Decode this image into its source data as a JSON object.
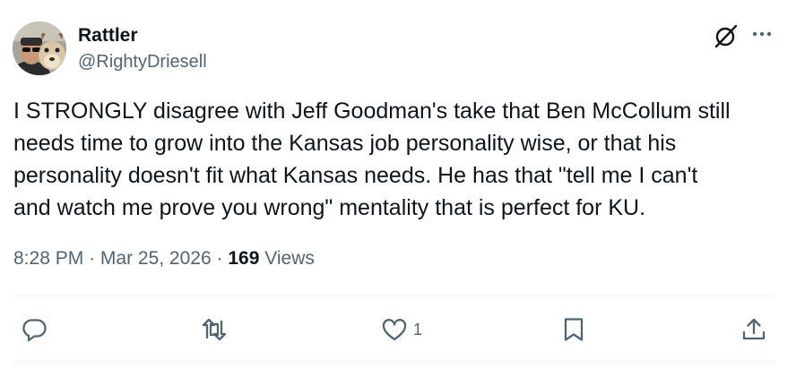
{
  "author": {
    "display_name": "Rattler",
    "handle": "@RightyDriesell"
  },
  "tweet": {
    "text": "I STRONGLY disagree with Jeff Goodman's take that Ben McCollum still\nneeds time to grow into the Kansas job personality wise, or that his\npersonality doesn't fit what Kansas needs. He has that \"tell me I can't\nand watch me prove you wrong\" mentality that is perfect for KU.",
    "time": "8:28 PM",
    "separator": "·",
    "date": "Mar 25, 2026",
    "views_count": "169",
    "views_label": "Views"
  },
  "actions": {
    "likes_count": "1"
  },
  "icons": {
    "header": [
      "grok-icon",
      "more-icon"
    ],
    "actions": [
      "reply-icon",
      "retweet-icon",
      "like-icon",
      "bookmark-icon",
      "share-icon"
    ]
  },
  "colors": {
    "text_primary": "#0f1419",
    "text_secondary": "#536471",
    "divider": "#eff3f4",
    "icon": "#536471"
  }
}
